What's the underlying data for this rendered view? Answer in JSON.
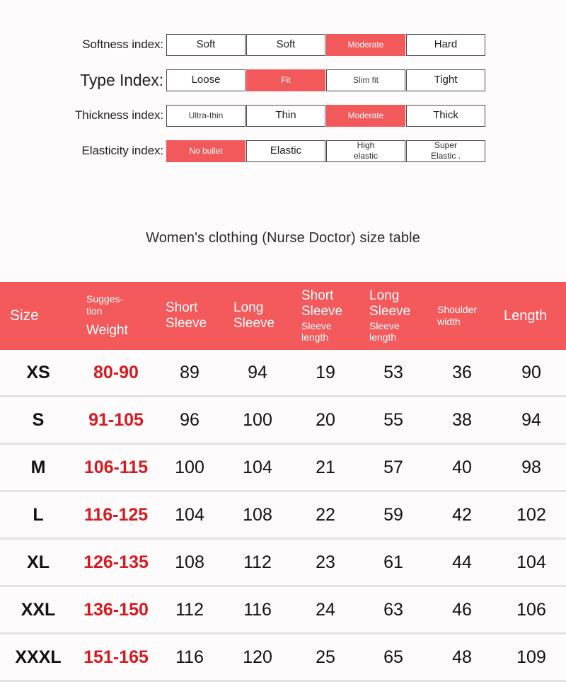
{
  "indexes": [
    {
      "label": "Softness index:",
      "label_size": "normal",
      "name": "softness",
      "options": [
        {
          "text": "Soft",
          "active": false,
          "style": "normal"
        },
        {
          "text": "Soft",
          "active": false,
          "style": "normal"
        },
        {
          "text": "Moderate",
          "active": true,
          "style": "normal"
        },
        {
          "text": "Hard",
          "active": false,
          "style": "normal"
        }
      ]
    },
    {
      "label": "Type Index:",
      "label_size": "big",
      "name": "type",
      "options": [
        {
          "text": "Loose",
          "active": false,
          "style": "normal"
        },
        {
          "text": "Fit",
          "active": true,
          "style": "normal"
        },
        {
          "text": "Slim fit",
          "active": false,
          "style": "small"
        },
        {
          "text": "Tight",
          "active": false,
          "style": "normal"
        }
      ]
    },
    {
      "label": "Thickness index:",
      "label_size": "normal",
      "name": "thickness",
      "options": [
        {
          "text": "Ultra-thin",
          "active": false,
          "style": "small"
        },
        {
          "text": "Thin",
          "active": false,
          "style": "normal"
        },
        {
          "text": "Moderate",
          "active": true,
          "style": "normal"
        },
        {
          "text": "Thick",
          "active": false,
          "style": "normal"
        }
      ]
    },
    {
      "label": "Elasticity index:",
      "label_size": "normal",
      "name": "elasticity",
      "options": [
        {
          "text": "No bullet",
          "active": true,
          "style": "normal"
        },
        {
          "text": "Elastic",
          "active": false,
          "style": "normal"
        },
        {
          "text": "High\nelastic",
          "active": false,
          "style": "two-line"
        },
        {
          "text": "Super\nElastic .",
          "active": false,
          "style": "two-line"
        }
      ]
    }
  ],
  "table": {
    "title": "Women's clothing (Nurse Doctor) size table",
    "header": [
      {
        "main": "Size",
        "sub": "",
        "kind": "size"
      },
      {
        "main": "",
        "sub_top": "Sugges-\ntion",
        "sub_bottom": "Weight",
        "kind": "stacked"
      },
      {
        "main": "Short\nSleeve",
        "sub": "",
        "kind": "main"
      },
      {
        "main": "Long\nSleeve",
        "sub": "",
        "kind": "main"
      },
      {
        "main": "Short\nSleeve",
        "sub": "Sleeve\nlength",
        "kind": "main-sub"
      },
      {
        "main": "Long\nSleeve",
        "sub": "Sleeve\nlength",
        "kind": "main-sub"
      },
      {
        "main": "",
        "sub": "Shoulder\nwidth",
        "kind": "sub-only"
      },
      {
        "main": "Length",
        "sub": "",
        "kind": "length"
      }
    ],
    "rows": [
      {
        "size": "XS",
        "weight": "80-90",
        "short_sleeve": "89",
        "long_sleeve": "94",
        "short_sleeve_length": "19",
        "long_sleeve_length": "53",
        "shoulder_width": "36",
        "length": "90"
      },
      {
        "size": "S",
        "weight": "91-105",
        "short_sleeve": "96",
        "long_sleeve": "100",
        "short_sleeve_length": "20",
        "long_sleeve_length": "55",
        "shoulder_width": "38",
        "length": "94"
      },
      {
        "size": "M",
        "weight": "106-115",
        "short_sleeve": "100",
        "long_sleeve": "104",
        "short_sleeve_length": "21",
        "long_sleeve_length": "57",
        "shoulder_width": "40",
        "length": "98"
      },
      {
        "size": "L",
        "weight": "116-125",
        "short_sleeve": "104",
        "long_sleeve": "108",
        "short_sleeve_length": "22",
        "long_sleeve_length": "59",
        "shoulder_width": "42",
        "length": "102"
      },
      {
        "size": "XL",
        "weight": "126-135",
        "short_sleeve": "108",
        "long_sleeve": "112",
        "short_sleeve_length": "23",
        "long_sleeve_length": "61",
        "shoulder_width": "44",
        "length": "104"
      },
      {
        "size": "XXL",
        "weight": "136-150",
        "short_sleeve": "112",
        "long_sleeve": "116",
        "short_sleeve_length": "24",
        "long_sleeve_length": "63",
        "shoulder_width": "46",
        "length": "106"
      },
      {
        "size": "XXXL",
        "weight": "151-165",
        "short_sleeve": "116",
        "long_sleeve": "120",
        "short_sleeve_length": "25",
        "long_sleeve_length": "65",
        "shoulder_width": "48",
        "length": "109"
      }
    ]
  },
  "colors": {
    "accent_red": "#f2595b",
    "header_red": "#f4595c",
    "weight_red": "#d61a21",
    "row_divider": "#e3e3e3",
    "page_background": "#fdfbfb"
  }
}
